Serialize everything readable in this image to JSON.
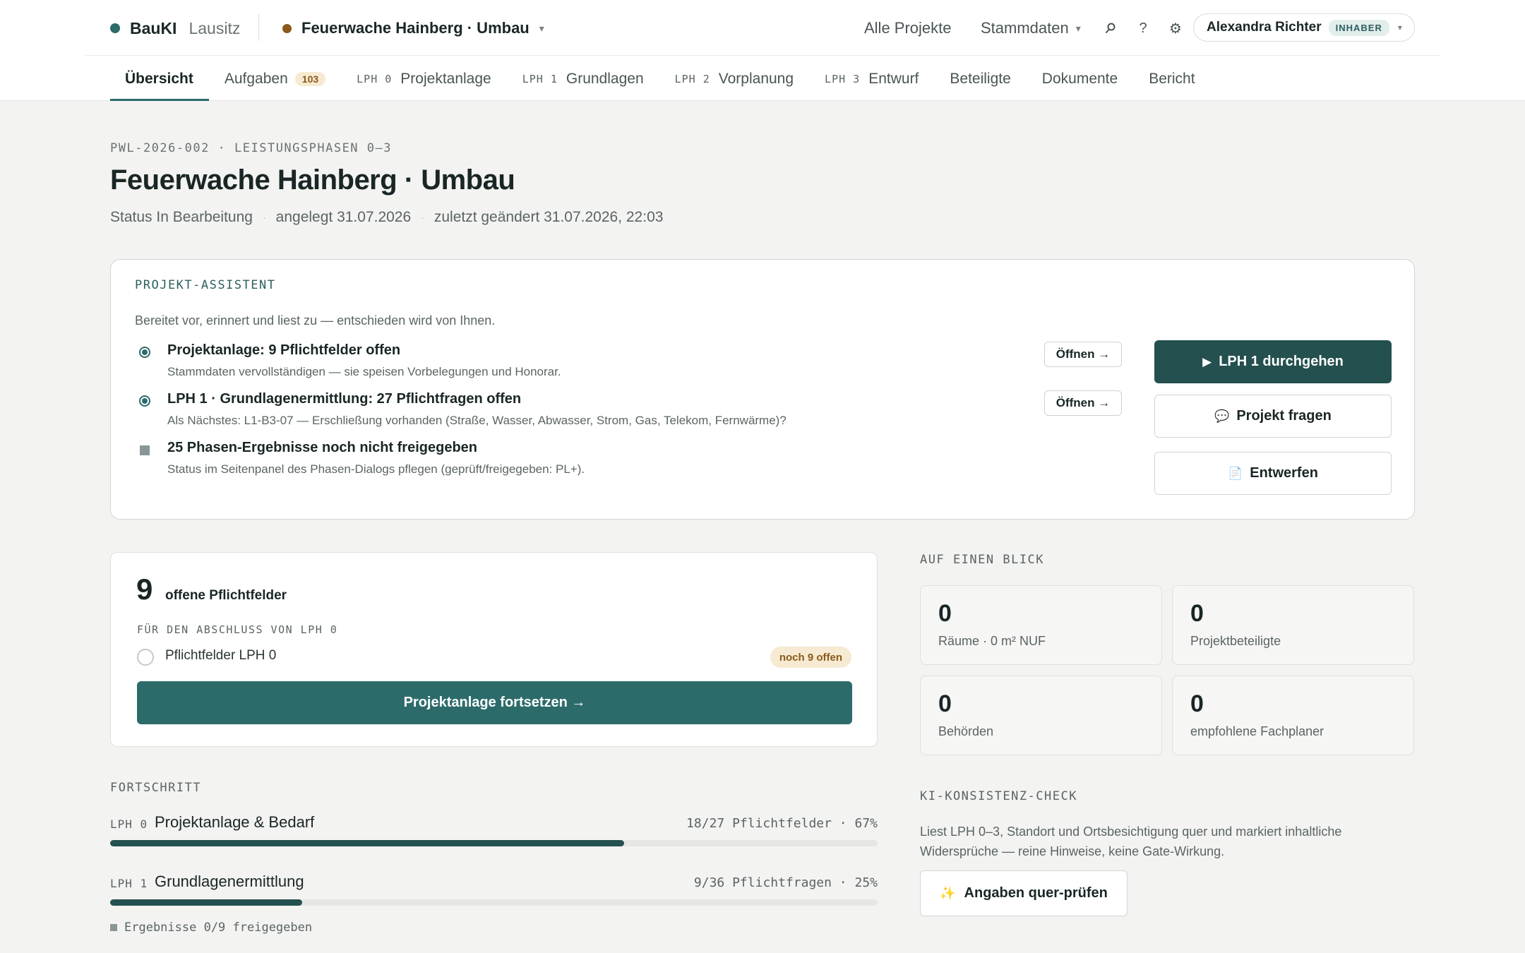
{
  "brand": {
    "name": "BauKI",
    "region": "Lausitz"
  },
  "project_switcher": {
    "title": "Feuerwache Hainberg · Umbau"
  },
  "topnav": {
    "all_projects": "Alle Projekte",
    "master_data": "Stammdaten"
  },
  "user": {
    "name": "Alexandra Richter",
    "role": "INHABER"
  },
  "tabs": [
    {
      "label": "Übersicht"
    },
    {
      "label": "Aufgaben",
      "badge": "103"
    },
    {
      "prefix": "LPH 0",
      "label": "Projektanlage"
    },
    {
      "prefix": "LPH 1",
      "label": "Grundlagen"
    },
    {
      "prefix": "LPH 2",
      "label": "Vorplanung"
    },
    {
      "prefix": "LPH 3",
      "label": "Entwurf"
    },
    {
      "label": "Beteiligte"
    },
    {
      "label": "Dokumente"
    },
    {
      "label": "Bericht"
    }
  ],
  "header": {
    "eyebrow": "PWL-2026-002 · LEISTUNGSPHASEN 0–3",
    "title": "Feuerwache Hainberg · Umbau",
    "status": "Status In Bearbeitung",
    "created": "angelegt 31.07.2026",
    "modified": "zuletzt geändert 31.07.2026, 22:03"
  },
  "assistant": {
    "label": "PROJEKT-ASSISTENT",
    "description": "Bereitet vor, erinnert und liest zu — entschieden wird von Ihnen.",
    "items": [
      {
        "title": "Projektanlage: 9 Pflichtfelder offen",
        "subtitle": "Stammdaten vervollständigen — sie speisen Vorbelegungen und Honorar.",
        "action": "Öffnen →"
      },
      {
        "title": "LPH 1 · Grundlagenermittlung: 27 Pflichtfragen offen",
        "subtitle": "Als Nächstes: L1-B3-07 — Erschließung vorhanden (Straße, Wasser, Abwasser, Strom, Gas, Telekom, Fernwärme)?",
        "action": "Öffnen →"
      },
      {
        "title": "25 Phasen-Ergebnisse noch nicht freigegeben",
        "subtitle": "Status im Seitenpanel des Phasen-Dialogs pflegen (geprüft/freigegeben: PL+)."
      }
    ],
    "buttons": {
      "primary": "LPH 1 durchgehen",
      "ask": "Projekt fragen",
      "draft": "Entwerfen"
    }
  },
  "required_fields": {
    "count": "9",
    "label": "offene Pflichtfelder",
    "sub": "FÜR DEN ABSCHLUSS VON LPH 0",
    "row_label": "Pflichtfelder LPH 0",
    "pill": "noch 9 offen",
    "cta": "Projektanlage fortsetzen →"
  },
  "progress": {
    "label": "FORTSCHRITT",
    "rows": [
      {
        "prefix": "LPH 0",
        "title": "Projektanlage & Bedarf",
        "count": "18/27 Pflichtfelder · 67%",
        "fraction": 0.67
      },
      {
        "prefix": "LPH 1",
        "title": "Grundlagenermittlung",
        "count": "9/36 Pflichtfragen · 25%",
        "fraction": 0.25
      }
    ],
    "release": "Ergebnisse 0/9 freigegeben"
  },
  "glance": {
    "label": "AUF EINEN BLICK",
    "stats": [
      {
        "value": "0",
        "label": "Räume · 0 m² NUF"
      },
      {
        "value": "0",
        "label": "Projektbeteiligte"
      },
      {
        "value": "0",
        "label": "Behörden"
      },
      {
        "value": "0",
        "label": "empfohlene Fachplaner"
      }
    ]
  },
  "ki_check": {
    "label": "KI-KONSISTENZ-CHECK",
    "description": "Liest LPH 0–3, Standort und Ortsbesichtigung quer und markiert inhaltliche Widersprüche — reine Hinweise, keine Gate-Wirkung.",
    "button": "Angaben quer-prüfen"
  },
  "colors": {
    "accent": "#2d6b6b",
    "accent_dark": "#24504f",
    "warning": "#8a5a1c",
    "warning_bg": "#f6ead2"
  },
  "icons": [
    "search-icon",
    "help-icon",
    "gear-icon",
    "chevron-down-icon",
    "play-icon",
    "chat-icon",
    "document-icon",
    "sparkle-icon"
  ]
}
